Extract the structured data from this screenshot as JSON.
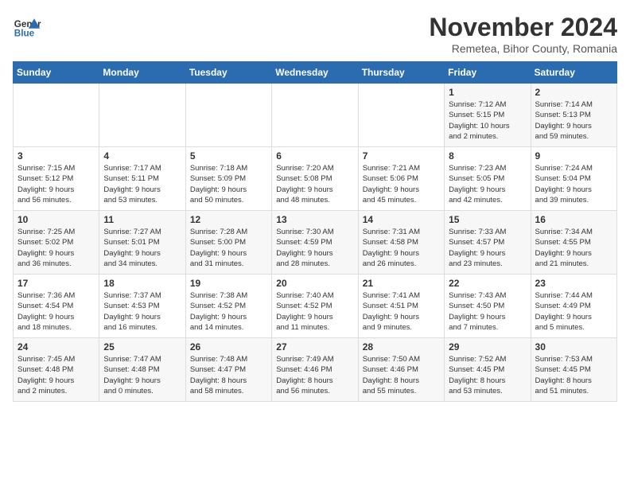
{
  "logo": {
    "line1": "General",
    "line2": "Blue"
  },
  "title": "November 2024",
  "subtitle": "Remetea, Bihor County, Romania",
  "days_of_week": [
    "Sunday",
    "Monday",
    "Tuesday",
    "Wednesday",
    "Thursday",
    "Friday",
    "Saturday"
  ],
  "weeks": [
    [
      {
        "day": "",
        "info": ""
      },
      {
        "day": "",
        "info": ""
      },
      {
        "day": "",
        "info": ""
      },
      {
        "day": "",
        "info": ""
      },
      {
        "day": "",
        "info": ""
      },
      {
        "day": "1",
        "info": "Sunrise: 7:12 AM\nSunset: 5:15 PM\nDaylight: 10 hours\nand 2 minutes."
      },
      {
        "day": "2",
        "info": "Sunrise: 7:14 AM\nSunset: 5:13 PM\nDaylight: 9 hours\nand 59 minutes."
      }
    ],
    [
      {
        "day": "3",
        "info": "Sunrise: 7:15 AM\nSunset: 5:12 PM\nDaylight: 9 hours\nand 56 minutes."
      },
      {
        "day": "4",
        "info": "Sunrise: 7:17 AM\nSunset: 5:11 PM\nDaylight: 9 hours\nand 53 minutes."
      },
      {
        "day": "5",
        "info": "Sunrise: 7:18 AM\nSunset: 5:09 PM\nDaylight: 9 hours\nand 50 minutes."
      },
      {
        "day": "6",
        "info": "Sunrise: 7:20 AM\nSunset: 5:08 PM\nDaylight: 9 hours\nand 48 minutes."
      },
      {
        "day": "7",
        "info": "Sunrise: 7:21 AM\nSunset: 5:06 PM\nDaylight: 9 hours\nand 45 minutes."
      },
      {
        "day": "8",
        "info": "Sunrise: 7:23 AM\nSunset: 5:05 PM\nDaylight: 9 hours\nand 42 minutes."
      },
      {
        "day": "9",
        "info": "Sunrise: 7:24 AM\nSunset: 5:04 PM\nDaylight: 9 hours\nand 39 minutes."
      }
    ],
    [
      {
        "day": "10",
        "info": "Sunrise: 7:25 AM\nSunset: 5:02 PM\nDaylight: 9 hours\nand 36 minutes."
      },
      {
        "day": "11",
        "info": "Sunrise: 7:27 AM\nSunset: 5:01 PM\nDaylight: 9 hours\nand 34 minutes."
      },
      {
        "day": "12",
        "info": "Sunrise: 7:28 AM\nSunset: 5:00 PM\nDaylight: 9 hours\nand 31 minutes."
      },
      {
        "day": "13",
        "info": "Sunrise: 7:30 AM\nSunset: 4:59 PM\nDaylight: 9 hours\nand 28 minutes."
      },
      {
        "day": "14",
        "info": "Sunrise: 7:31 AM\nSunset: 4:58 PM\nDaylight: 9 hours\nand 26 minutes."
      },
      {
        "day": "15",
        "info": "Sunrise: 7:33 AM\nSunset: 4:57 PM\nDaylight: 9 hours\nand 23 minutes."
      },
      {
        "day": "16",
        "info": "Sunrise: 7:34 AM\nSunset: 4:55 PM\nDaylight: 9 hours\nand 21 minutes."
      }
    ],
    [
      {
        "day": "17",
        "info": "Sunrise: 7:36 AM\nSunset: 4:54 PM\nDaylight: 9 hours\nand 18 minutes."
      },
      {
        "day": "18",
        "info": "Sunrise: 7:37 AM\nSunset: 4:53 PM\nDaylight: 9 hours\nand 16 minutes."
      },
      {
        "day": "19",
        "info": "Sunrise: 7:38 AM\nSunset: 4:52 PM\nDaylight: 9 hours\nand 14 minutes."
      },
      {
        "day": "20",
        "info": "Sunrise: 7:40 AM\nSunset: 4:52 PM\nDaylight: 9 hours\nand 11 minutes."
      },
      {
        "day": "21",
        "info": "Sunrise: 7:41 AM\nSunset: 4:51 PM\nDaylight: 9 hours\nand 9 minutes."
      },
      {
        "day": "22",
        "info": "Sunrise: 7:43 AM\nSunset: 4:50 PM\nDaylight: 9 hours\nand 7 minutes."
      },
      {
        "day": "23",
        "info": "Sunrise: 7:44 AM\nSunset: 4:49 PM\nDaylight: 9 hours\nand 5 minutes."
      }
    ],
    [
      {
        "day": "24",
        "info": "Sunrise: 7:45 AM\nSunset: 4:48 PM\nDaylight: 9 hours\nand 2 minutes."
      },
      {
        "day": "25",
        "info": "Sunrise: 7:47 AM\nSunset: 4:48 PM\nDaylight: 9 hours\nand 0 minutes."
      },
      {
        "day": "26",
        "info": "Sunrise: 7:48 AM\nSunset: 4:47 PM\nDaylight: 8 hours\nand 58 minutes."
      },
      {
        "day": "27",
        "info": "Sunrise: 7:49 AM\nSunset: 4:46 PM\nDaylight: 8 hours\nand 56 minutes."
      },
      {
        "day": "28",
        "info": "Sunrise: 7:50 AM\nSunset: 4:46 PM\nDaylight: 8 hours\nand 55 minutes."
      },
      {
        "day": "29",
        "info": "Sunrise: 7:52 AM\nSunset: 4:45 PM\nDaylight: 8 hours\nand 53 minutes."
      },
      {
        "day": "30",
        "info": "Sunrise: 7:53 AM\nSunset: 4:45 PM\nDaylight: 8 hours\nand 51 minutes."
      }
    ]
  ]
}
